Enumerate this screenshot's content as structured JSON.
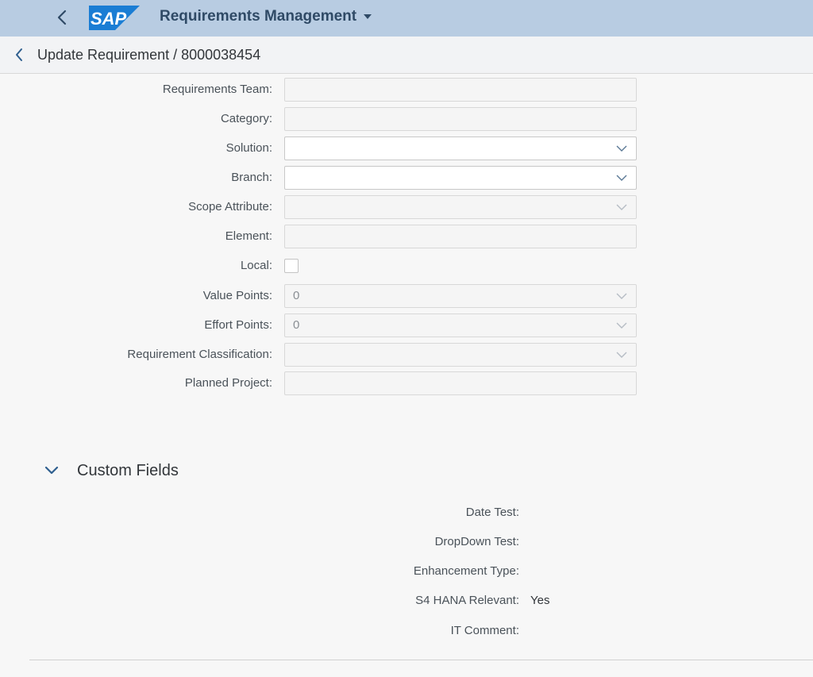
{
  "shell": {
    "logo_text": "SAP",
    "app_title": "Requirements Management",
    "colors": {
      "bar": "#b8cce2",
      "logo": "#1a7dd4",
      "title": "#2f4a66"
    },
    "icons": {
      "back": "chevron-left-icon",
      "menu": "caret-down-icon"
    }
  },
  "header": {
    "title": "Update Requirement / 8000038454",
    "back_icon": "chevron-left-icon"
  },
  "form": {
    "requirements_team": {
      "label": "Requirements Team:",
      "value": ""
    },
    "category": {
      "label": "Category:",
      "value": ""
    },
    "solution": {
      "label": "Solution:",
      "value": ""
    },
    "branch": {
      "label": "Branch:",
      "value": ""
    },
    "scope_attribute": {
      "label": "Scope Attribute:",
      "value": ""
    },
    "element": {
      "label": "Element:",
      "value": ""
    },
    "local": {
      "label": "Local:",
      "checked": false
    },
    "value_points": {
      "label": "Value Points:",
      "value": "0"
    },
    "effort_points": {
      "label": "Effort Points:",
      "value": "0"
    },
    "requirement_classification": {
      "label": "Requirement Classification:",
      "value": ""
    },
    "planned_project": {
      "label": "Planned Project:",
      "value": ""
    }
  },
  "custom_fields": {
    "title": "Custom Fields",
    "expanded": true,
    "items": [
      {
        "label": "Date Test:",
        "value": ""
      },
      {
        "label": "DropDown Test:",
        "value": ""
      },
      {
        "label": "Enhancement Type:",
        "value": ""
      },
      {
        "label": "S4 HANA Relevant:",
        "value": "Yes"
      },
      {
        "label": "IT Comment:",
        "value": ""
      }
    ]
  }
}
